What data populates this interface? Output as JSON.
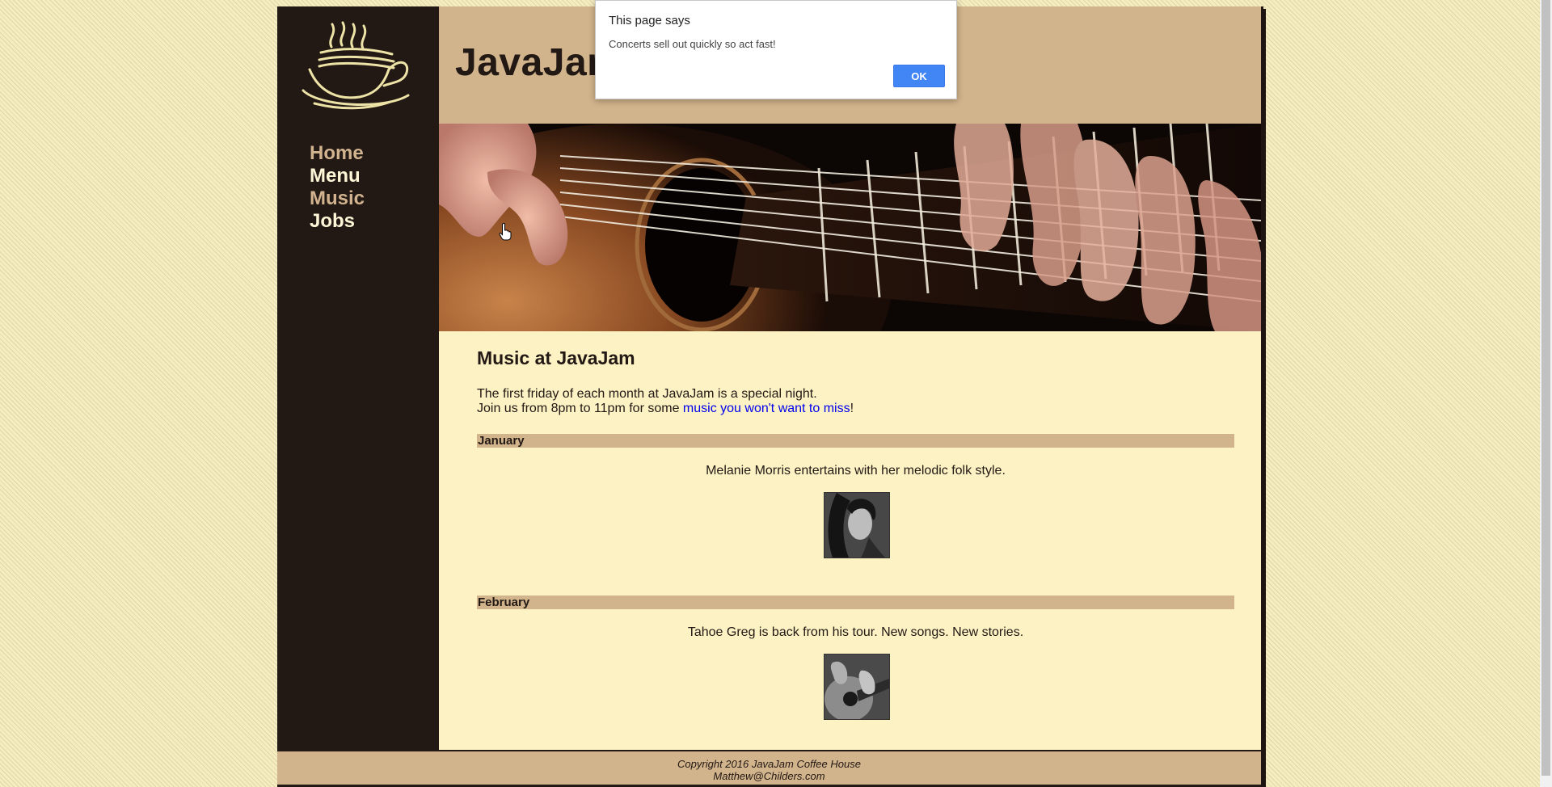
{
  "site": {
    "title": "JavaJam Coffee House"
  },
  "nav": {
    "items": [
      "Home",
      "Menu",
      "Music",
      "Jobs"
    ]
  },
  "main": {
    "heading": "Music at JavaJam",
    "intro_line1": "The first friday of each month at JavaJam is a special night.",
    "intro_line2_prefix": "Join us from 8pm to 11pm for some ",
    "intro_link": "music you won't want to miss",
    "intro_line2_suffix": "!"
  },
  "events": [
    {
      "month": "January",
      "description": "Melanie Morris entertains with her melodic folk style."
    },
    {
      "month": "February",
      "description": "Tahoe Greg is back from his tour. New songs. New stories."
    }
  ],
  "footer": {
    "copyright": "Copyright 2016 JavaJam Coffee House",
    "email": "Matthew@Childers.com"
  },
  "dialog": {
    "title": "This page says",
    "message": "Concerts sell out quickly so act fast!",
    "ok_label": "OK"
  },
  "colors": {
    "sidebar": "#221814",
    "tan": "#d2b48c",
    "content_bg": "#fcf2c4",
    "page_bg": "#f5edc0",
    "link": "#0000ee",
    "dialog_button": "#4285f4"
  }
}
